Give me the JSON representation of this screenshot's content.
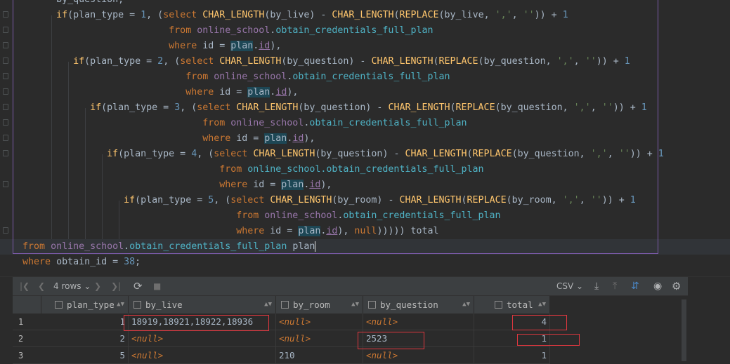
{
  "code_lines": [
    {
      "indent": "        ",
      "segs": [
        [
          "by_question,",
          "ids"
        ]
      ]
    },
    {
      "indent": "        ",
      "segs": [
        [
          "if",
          "fn"
        ],
        [
          "(plan_type = ",
          ""
        ],
        [
          "1",
          "num"
        ],
        [
          ", (",
          ""
        ],
        [
          "select",
          "kw"
        ],
        [
          " ",
          ""
        ],
        [
          "CHAR_LENGTH",
          "fn"
        ],
        [
          "(by_live) - ",
          ""
        ],
        [
          "CHAR_LENGTH",
          "fn"
        ],
        [
          "(",
          ""
        ],
        [
          "REPLACE",
          "fn"
        ],
        [
          "(by_live, ",
          ""
        ],
        [
          "','",
          "str"
        ],
        [
          ", ",
          ""
        ],
        [
          "''",
          "str"
        ],
        [
          ")) + ",
          ""
        ],
        [
          "1",
          "num"
        ]
      ]
    },
    {
      "indent": "                            ",
      "segs": [
        [
          "from",
          "kw"
        ],
        [
          " ",
          ""
        ],
        [
          "online_school",
          "sch"
        ],
        [
          ".",
          ""
        ],
        [
          "obtain_credentials_full_plan",
          "tbl"
        ]
      ]
    },
    {
      "indent": "                            ",
      "segs": [
        [
          "where",
          "kw"
        ],
        [
          " id = ",
          ""
        ],
        [
          "plan",
          "pl"
        ],
        [
          ".",
          ""
        ],
        [
          "id",
          "prp"
        ],
        [
          "),",
          ""
        ]
      ]
    },
    {
      "indent": "           ",
      "segs": [
        [
          "if",
          "fn"
        ],
        [
          "(plan_type = ",
          ""
        ],
        [
          "2",
          "num"
        ],
        [
          ", (",
          ""
        ],
        [
          "select",
          "kw"
        ],
        [
          " ",
          ""
        ],
        [
          "CHAR_LENGTH",
          "fn"
        ],
        [
          "(by_question) - ",
          ""
        ],
        [
          "CHAR_LENGTH",
          "fn"
        ],
        [
          "(",
          ""
        ],
        [
          "REPLACE",
          "fn"
        ],
        [
          "(by_question, ",
          ""
        ],
        [
          "','",
          "str"
        ],
        [
          ", ",
          ""
        ],
        [
          "''",
          "str"
        ],
        [
          ")) + ",
          ""
        ],
        [
          "1",
          "num"
        ]
      ]
    },
    {
      "indent": "                               ",
      "segs": [
        [
          "from",
          "kw"
        ],
        [
          " ",
          ""
        ],
        [
          "online_school",
          "sch"
        ],
        [
          ".",
          ""
        ],
        [
          "obtain_credentials_full_plan",
          "tbl"
        ]
      ]
    },
    {
      "indent": "                               ",
      "segs": [
        [
          "where",
          "kw"
        ],
        [
          " id = ",
          ""
        ],
        [
          "plan",
          "pl"
        ],
        [
          ".",
          ""
        ],
        [
          "id",
          "prp"
        ],
        [
          "),",
          ""
        ]
      ]
    },
    {
      "indent": "              ",
      "segs": [
        [
          "if",
          "fn"
        ],
        [
          "(plan_type = ",
          ""
        ],
        [
          "3",
          "num"
        ],
        [
          ", (",
          ""
        ],
        [
          "select",
          "kw"
        ],
        [
          " ",
          ""
        ],
        [
          "CHAR_LENGTH",
          "fn"
        ],
        [
          "(by_question) - ",
          ""
        ],
        [
          "CHAR_LENGTH",
          "fn"
        ],
        [
          "(",
          ""
        ],
        [
          "REPLACE",
          "fn"
        ],
        [
          "(by_question, ",
          ""
        ],
        [
          "','",
          "str"
        ],
        [
          ", ",
          ""
        ],
        [
          "''",
          "str"
        ],
        [
          ")) + ",
          ""
        ],
        [
          "1",
          "num"
        ]
      ]
    },
    {
      "indent": "                                  ",
      "segs": [
        [
          "from",
          "kw"
        ],
        [
          " ",
          ""
        ],
        [
          "online_school",
          "sch"
        ],
        [
          ".",
          ""
        ],
        [
          "obtain_credentials_full_plan",
          "tbl"
        ]
      ]
    },
    {
      "indent": "                                  ",
      "segs": [
        [
          "where",
          "kw"
        ],
        [
          " id = ",
          ""
        ],
        [
          "plan",
          "pl"
        ],
        [
          ".",
          ""
        ],
        [
          "id",
          "prp"
        ],
        [
          "),",
          ""
        ]
      ]
    },
    {
      "indent": "                 ",
      "segs": [
        [
          "if",
          "fn"
        ],
        [
          "(plan_type = ",
          ""
        ],
        [
          "4",
          "num"
        ],
        [
          ", (",
          ""
        ],
        [
          "select",
          "kw"
        ],
        [
          " ",
          ""
        ],
        [
          "CHAR_LENGTH",
          "fn"
        ],
        [
          "(by_question) - ",
          ""
        ],
        [
          "CHAR_LENGTH",
          "fn"
        ],
        [
          "(",
          ""
        ],
        [
          "REPLACE",
          "fn"
        ],
        [
          "(by_question, ",
          ""
        ],
        [
          "','",
          "str"
        ],
        [
          ", ",
          ""
        ],
        [
          "''",
          "str"
        ],
        [
          ")) + ",
          ""
        ],
        [
          "1",
          "num"
        ]
      ]
    },
    {
      "indent": "                                     ",
      "segs": [
        [
          "from",
          "kw"
        ],
        [
          " ",
          ""
        ],
        [
          "online_school.obtain_credentials_full_plan",
          "tbl"
        ]
      ]
    },
    {
      "indent": "                                     ",
      "segs": [
        [
          "where",
          "kw"
        ],
        [
          " id = ",
          ""
        ],
        [
          "plan",
          "pl"
        ],
        [
          ".",
          ""
        ],
        [
          "id",
          "prp"
        ],
        [
          "),",
          ""
        ]
      ]
    },
    {
      "indent": "                    ",
      "segs": [
        [
          "if",
          "fn"
        ],
        [
          "(plan_type = ",
          ""
        ],
        [
          "5",
          "num"
        ],
        [
          ", (",
          ""
        ],
        [
          "select",
          "kw"
        ],
        [
          " ",
          ""
        ],
        [
          "CHAR_LENGTH",
          "fn"
        ],
        [
          "(by_room) - ",
          ""
        ],
        [
          "CHAR_LENGTH",
          "fn"
        ],
        [
          "(",
          ""
        ],
        [
          "REPLACE",
          "fn"
        ],
        [
          "(by_room, ",
          ""
        ],
        [
          "','",
          "str"
        ],
        [
          ", ",
          ""
        ],
        [
          "''",
          "str"
        ],
        [
          ")) + ",
          ""
        ],
        [
          "1",
          "num"
        ]
      ]
    },
    {
      "indent": "                                        ",
      "segs": [
        [
          "from",
          "kw"
        ],
        [
          " ",
          ""
        ],
        [
          "online_school",
          "sch"
        ],
        [
          ".",
          ""
        ],
        [
          "obtain_credentials_full_plan",
          "tbl"
        ]
      ]
    },
    {
      "indent": "                                        ",
      "segs": [
        [
          "where",
          "kw"
        ],
        [
          " id = ",
          ""
        ],
        [
          "plan",
          "pl"
        ],
        [
          ".",
          ""
        ],
        [
          "id",
          "prp"
        ],
        [
          "), ",
          ""
        ],
        [
          "null",
          "kw"
        ],
        [
          "))))) total",
          ""
        ]
      ]
    },
    {
      "indent": "  ",
      "segs": [
        [
          "from",
          "kw"
        ],
        [
          " ",
          ""
        ],
        [
          "online_school",
          "sch"
        ],
        [
          ".",
          ""
        ],
        [
          "obtain_credentials_full_plan",
          "tbl"
        ],
        [
          " plan",
          ""
        ]
      ]
    },
    {
      "indent": "  ",
      "segs": [
        [
          "where",
          "kw"
        ],
        [
          " obtain_id = ",
          ""
        ],
        [
          "38",
          "num"
        ],
        [
          ";",
          ""
        ]
      ]
    }
  ],
  "toolbar": {
    "first_icon": "first-page-icon",
    "prev_icon": "prev-page-icon",
    "rows_label": "4 rows",
    "next_icon": "next-page-icon",
    "last_icon": "last-page-icon",
    "refresh_icon": "refresh-icon",
    "stop_icon": "stop-icon",
    "format": "CSV",
    "download_icon": "download-icon",
    "upload_icon": "upload-icon",
    "compare_icon": "compare-icon",
    "view_icon": "eye-icon",
    "settings_icon": "gear-icon"
  },
  "grid": {
    "columns": [
      "plan_type",
      "by_live",
      "by_room",
      "by_question",
      "total"
    ],
    "rows": [
      {
        "num": "1",
        "plan_type": "1",
        "by_live": "18919,18921,18922,18936",
        "by_room": "<null>",
        "by_question": "<null>",
        "total": "4"
      },
      {
        "num": "2",
        "plan_type": "2",
        "by_live": "<null>",
        "by_room": "<null>",
        "by_question": "2523",
        "total": "1"
      },
      {
        "num": "3",
        "plan_type": "5",
        "by_live": "<null>",
        "by_room": "210",
        "by_question": "<null>",
        "total": "1"
      }
    ]
  },
  "colors": {
    "annotation_box": "#e0373f",
    "selection_frame": "#7b5aa8"
  }
}
